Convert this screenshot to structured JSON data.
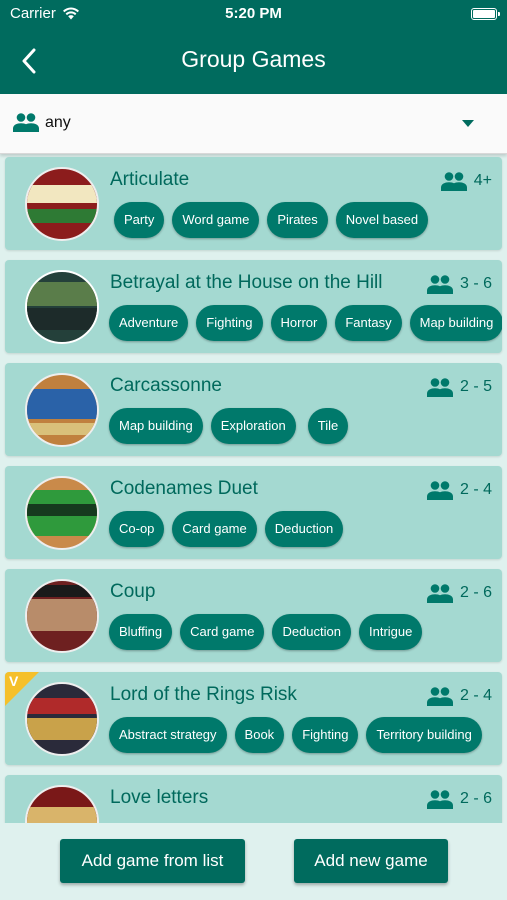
{
  "status_bar": {
    "carrier": "Carrier",
    "time": "5:20 PM"
  },
  "nav": {
    "title": "Group Games"
  },
  "filter": {
    "value": "any"
  },
  "colors": {
    "primary": "#006b5e",
    "card": "#a4d9d1",
    "chip": "#00796b",
    "badge": "#f5c02a"
  },
  "games": [
    {
      "name": "Articulate",
      "players": "4+",
      "tags": [
        "Party",
        "Word game",
        "Pirates",
        "Novel based"
      ]
    },
    {
      "name": "Betrayal at the House on the Hill",
      "players": "3 - 6",
      "tags": [
        "Adventure",
        "Fighting",
        "Horror",
        "Fantasy",
        "Map building"
      ]
    },
    {
      "name": "Carcassonne",
      "players": "2 - 5",
      "tags": [
        "Map building",
        "Exploration",
        "Tile"
      ]
    },
    {
      "name": "Codenames Duet",
      "players": "2 - 4",
      "tags": [
        "Co-op",
        "Card game",
        "Deduction"
      ]
    },
    {
      "name": "Coup",
      "players": "2 - 6",
      "tags": [
        "Bluffing",
        "Card game",
        "Deduction",
        "Intrigue"
      ]
    },
    {
      "name": "Lord of the Rings Risk",
      "players": "2 - 4",
      "badge": "V",
      "tags": [
        "Abstract strategy",
        "Book",
        "Fighting",
        "Territory building"
      ]
    },
    {
      "name": "Love letters",
      "players": "2 - 6",
      "tags": []
    }
  ],
  "footer": {
    "add_from_list": "Add game from list",
    "add_new": "Add new game"
  }
}
